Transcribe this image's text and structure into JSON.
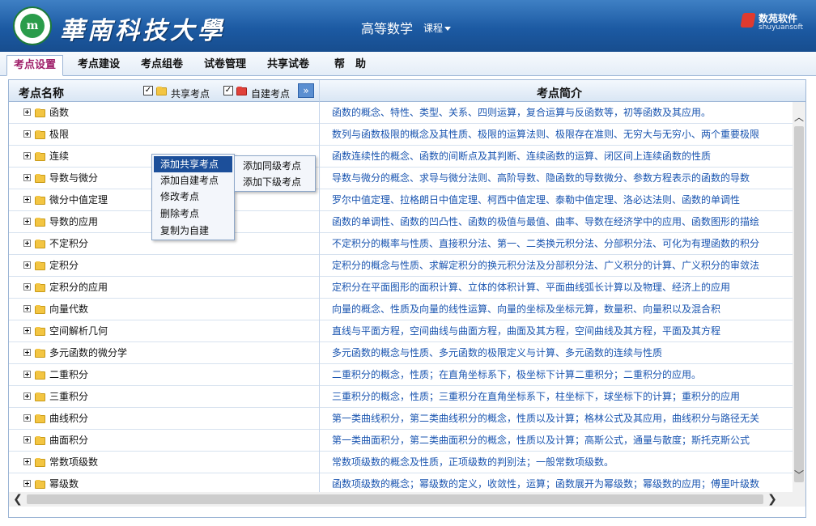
{
  "header": {
    "university_name": "華南科技大學",
    "logo_letters": "m",
    "course_title": "高等数学",
    "course_menu_label": "课程",
    "brand_cn": "数苑软件",
    "brand_en": "shuyuansoft"
  },
  "tabs": [
    {
      "label": "考点设置",
      "active": true
    },
    {
      "label": "考点建设",
      "active": false
    },
    {
      "label": "考点组卷",
      "active": false
    },
    {
      "label": "试卷管理",
      "active": false
    },
    {
      "label": "共享试卷",
      "active": false
    },
    {
      "label": "帮　助",
      "active": false
    }
  ],
  "table": {
    "left_header": "考点名称",
    "right_header": "考点简介",
    "filter_shared": {
      "label": "共享考点",
      "checked": true,
      "check_mark": "✓"
    },
    "filter_custom": {
      "label": "自建考点",
      "checked": true,
      "check_mark": "✓"
    },
    "expand_button": "»",
    "rows": [
      {
        "name": "函数",
        "desc": "函数的概念、特性、类型、关系、四则运算，复合运算与反函数等，初等函数及其应用。"
      },
      {
        "name": "极限",
        "desc": "数列与函数极限的概念及其性质、极限的运算法则、极限存在准则、无穷大与无穷小、两个重要极限"
      },
      {
        "name": "连续",
        "desc": "函数连续性的概念、函数的间断点及其判断、连续函数的运算、闭区间上连续函数的性质"
      },
      {
        "name": "导数与微分",
        "desc": "导数与微分的概念、求导与微分法则、高阶导数、隐函数的导数微分、参数方程表示的函数的导数"
      },
      {
        "name": "微分中值定理",
        "desc": "罗尔中值定理、拉格朗日中值定理、柯西中值定理、泰勒中值定理、洛必达法则、函数的单调性"
      },
      {
        "name": "导数的应用",
        "desc": "函数的单调性、函数的凹凸性、函数的极值与最值、曲率、导数在经济学中的应用、函数图形的描绘"
      },
      {
        "name": "不定积分",
        "desc": "不定积分的概率与性质、直接积分法、第一、二类换元积分法、分部积分法、可化为有理函数的积分"
      },
      {
        "name": "定积分",
        "desc": "定积分的概念与性质、求解定积分的换元积分法及分部积分法、广义积分的计算、广义积分的审敛法"
      },
      {
        "name": "定积分的应用",
        "desc": "定积分在平面图形的面积计算、立体的体积计算、平面曲线弧长计算以及物理、经济上的应用"
      },
      {
        "name": "向量代数",
        "desc": "向量的概念、性质及向量的线性运算、向量的坐标及坐标元算，数量积、向量积以及混合积"
      },
      {
        "name": "空间解析几何",
        "desc": "直线与平面方程，空间曲线与曲面方程，曲面及其方程，空间曲线及其方程，平面及其方程"
      },
      {
        "name": "多元函数的微分学",
        "desc": "多元函数的概念与性质、多元函数的极限定义与计算、多元函数的连续与性质"
      },
      {
        "name": "二重积分",
        "desc": "二重积分的概念，性质；在直角坐标系下，极坐标下计算二重积分；二重积分的应用。"
      },
      {
        "name": "三重积分",
        "desc": "三重积分的概念，性质；三重积分在直角坐标系下，柱坐标下，球坐标下的计算；重积分的应用"
      },
      {
        "name": "曲线积分",
        "desc": "第一类曲线积分，第二类曲线积分的概念，性质以及计算；格林公式及其应用，曲线积分与路径无关"
      },
      {
        "name": "曲面积分",
        "desc": "第一类曲面积分，第二类曲面积分的概念，性质以及计算；高斯公式，通量与散度；斯托克斯公式"
      },
      {
        "name": "常数项级数",
        "desc": "常数项级数的概念及性质，正项级数的判别法；一般常数项级数。"
      },
      {
        "name": "幂级数",
        "desc": "函数项级数的概念；幂级数的定义，收敛性，运算；函数展开为幂级数；幂级数的应用；傅里叶级数"
      }
    ]
  },
  "context_menu": {
    "items": [
      "添加共享考点",
      "添加自建考点",
      "修改考点",
      "删除考点",
      "复制为自建"
    ],
    "highlighted_index": 0
  },
  "submenu": {
    "items": [
      "添加同级考点",
      "添加下级考点"
    ]
  },
  "scrollbar": {
    "up": "︿",
    "down": "﹀",
    "left": "❮",
    "right": "❯"
  },
  "colors": {
    "header_blue": "#1c5aa3",
    "link_blue": "#1a55b0",
    "active_tab": "#a0206a",
    "menu_highlight": "#1c4f9a"
  }
}
